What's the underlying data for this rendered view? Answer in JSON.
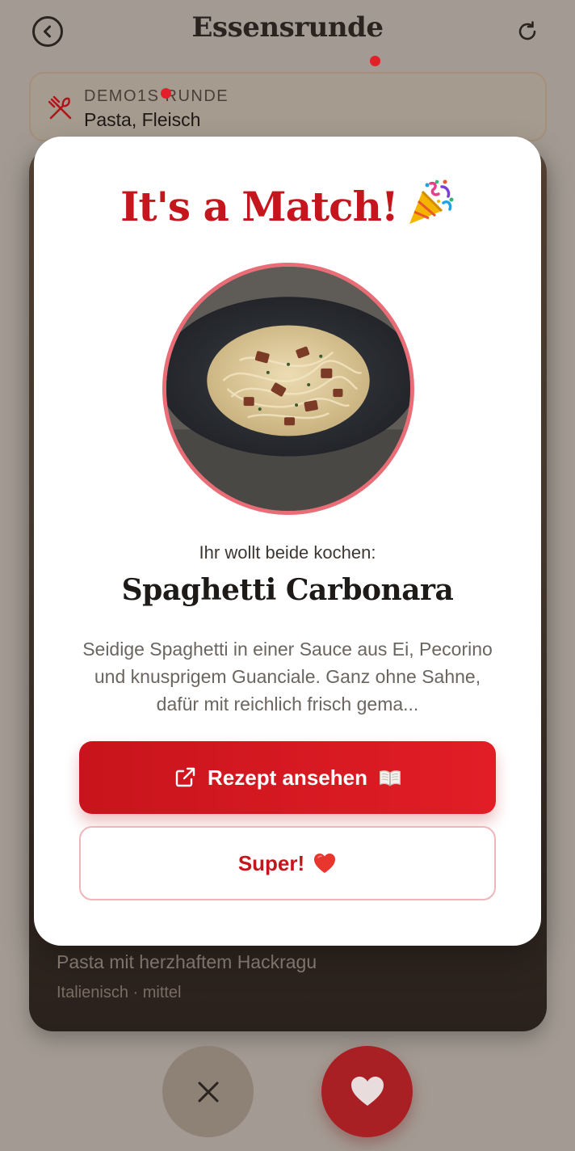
{
  "header": {
    "title": "Essensrunde"
  },
  "round": {
    "label": "DEMO1S RUNDE",
    "value": "Pasta, Fleisch"
  },
  "background_card": {
    "subtitle": "Pasta mit herzhaftem Hackragu",
    "meta": "Italienisch · mittel"
  },
  "modal": {
    "title": "It's a Match!",
    "subtitle": "Ihr wollt beide kochen:",
    "dish_name": "Spaghetti Carbonara",
    "description": "Seidige Spaghetti in einer Sauce aus Ei, Pecorino und knusprigem Guanciale. Ganz ohne Sahne, dafür mit reichlich frisch gema...",
    "recipe_button": "Rezept ansehen",
    "super_button": "Super!"
  },
  "icons": {
    "back": "back-icon",
    "refresh": "refresh-icon",
    "cutlery": "cutlery-icon",
    "party": "party-popper-icon",
    "external_link": "external-link-icon",
    "book": "book-icon",
    "heart": "heart-icon",
    "close": "close-icon"
  },
  "colors": {
    "accent": "#c4161c",
    "accent_light": "#e21d26",
    "notification_dot": "#e3202a",
    "overlay_background": "#a39b93"
  }
}
